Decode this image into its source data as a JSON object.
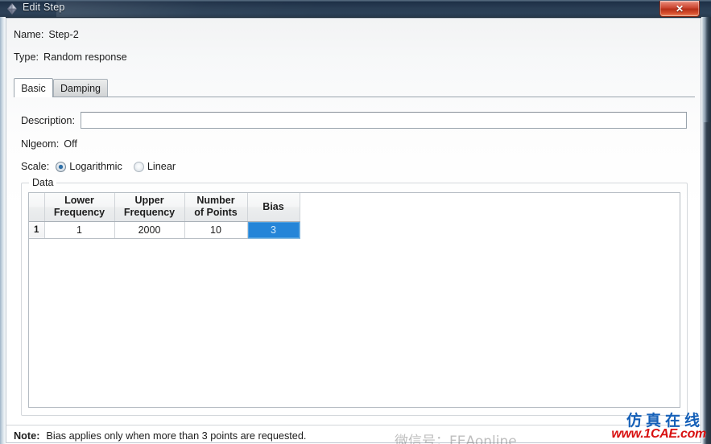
{
  "window": {
    "title": "Edit Step",
    "icon": "abaqus-diamond-icon",
    "close_label": "✕"
  },
  "header": {
    "name_key": "Name:",
    "name_value": "Step-2",
    "type_key": "Type:",
    "type_value": "Random response"
  },
  "tabs": [
    {
      "label": "Basic",
      "active": true
    },
    {
      "label": "Damping",
      "active": false
    }
  ],
  "basic": {
    "description_label": "Description:",
    "description_value": "",
    "description_placeholder": "",
    "nlgeom_key": "Nlgeom:",
    "nlgeom_value": "Off",
    "scale_key": "Scale:",
    "scale_options": [
      {
        "label": "Logarithmic",
        "selected": true
      },
      {
        "label": "Linear",
        "selected": false
      }
    ]
  },
  "data_group": {
    "legend": "Data",
    "columns": [
      {
        "line1": "Lower",
        "line2": "Frequency"
      },
      {
        "line1": "Upper",
        "line2": "Frequency"
      },
      {
        "line1": "Number",
        "line2": "of Points"
      },
      {
        "line1": "Bias",
        "line2": ""
      }
    ],
    "rows": [
      {
        "number": "1",
        "lower_frequency": "1",
        "upper_frequency": "2000",
        "number_of_points": "10",
        "bias": "3",
        "selected_cell": "bias"
      }
    ]
  },
  "note": {
    "prefix": "Note:",
    "text": "Bias applies only when more than 3 points are requested."
  },
  "watermarks": {
    "faint_center": "1CAE.COM",
    "chinese": "仿真在线",
    "url": "www.1CAE.com",
    "wechat": "微信号：FEAonline"
  },
  "colors": {
    "titlebar": "#22364e",
    "accent_selected_cell": "#2585d8",
    "radio_dot": "#2d6fa8",
    "close_red": "#c8402a",
    "watermark_blue": "#1560b8",
    "watermark_red": "#d81010"
  }
}
